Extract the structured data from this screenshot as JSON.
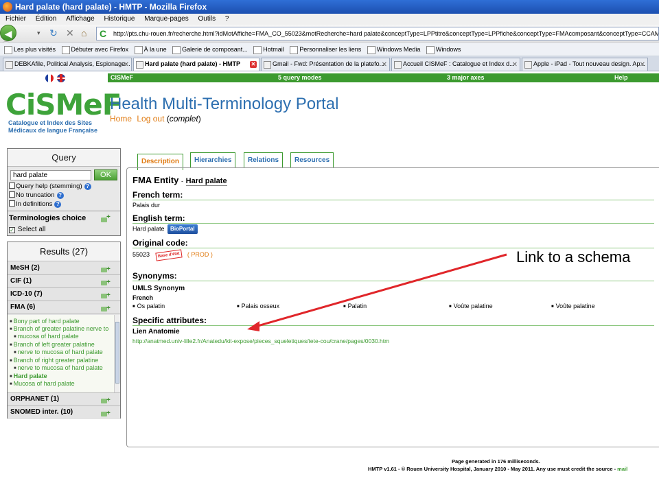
{
  "window": {
    "title": "Hard palate (hard palate) - HMTP - Mozilla Firefox"
  },
  "menu": [
    "Fichier",
    "Édition",
    "Affichage",
    "Historique",
    "Marque-pages",
    "Outils",
    "?"
  ],
  "url": "http://pts.chu-rouen.fr/recherche.html?idMotAffiche=FMA_CO_55023&motRecherche=hard palate&conceptType=LPPtitre&conceptType=LPPfiche&conceptType=FMAcomposant&conceptType=CCAMorgane&conceptTyp",
  "bookmarks": [
    "Les plus visités",
    "Débuter avec Firefox",
    "À la une",
    "Galerie de composant...",
    "Hotmail",
    "Personnaliser les liens",
    "Windows Media",
    "Windows"
  ],
  "tabs": [
    {
      "label": "DEBKAfile, Political Analysis, Espionage..."
    },
    {
      "label": "Hard palate (hard palate) - HMTP"
    },
    {
      "label": "Gmail - Fwd: Présentation de la platefo..."
    },
    {
      "label": "Accueil CISMeF : Catalogue et Index d..."
    },
    {
      "label": "Apple - iPad - Tout nouveau design. Ap..."
    }
  ],
  "topnav": {
    "brand": "CISMeF",
    "modes": "5 query modes",
    "axes": "3 major axes",
    "help": "Help"
  },
  "logo": {
    "word": "CiSMeF",
    "sub1": "Catalogue et Index des Sites",
    "sub2": "Médicaux de langue Française"
  },
  "portal": {
    "title": "Health Multi-Terminology Portal",
    "home": "Home",
    "logout": "Log out",
    "open": "(",
    "mode": "complet",
    "close": ")"
  },
  "query": {
    "title": "Query",
    "value": "hard palate",
    "ok": "OK",
    "opt1": "Query help (stemming)",
    "opt2": "No truncation",
    "opt3": "In definitions",
    "terminologies": "Terminologies choice",
    "select_all": "Select all"
  },
  "results": {
    "title": "Results (27)",
    "mesh": "MeSH (2)",
    "cif": "CIF (1)",
    "icd": "ICD-10 (7)",
    "fma": "FMA (6)",
    "fma_items": [
      "Bony part of hard palate",
      "Branch of greater palatine nerve to",
      "mucosa of hard palate",
      "Branch of left greater palatine",
      "nerve to mucosa of hard palate",
      "Branch of right greater palatine",
      "nerve to mucosa of hard palate",
      "Hard palate",
      "Mucosa of hard palate"
    ],
    "orphanet": "ORPHANET (1)",
    "snomed": "SNOMED inter. (10)"
  },
  "content_tabs": [
    "Description",
    "Hierarchies",
    "Relations",
    "Resources"
  ],
  "entity": {
    "label": "FMA Entity",
    "dash": "-",
    "name": "Hard palate"
  },
  "french_term": {
    "title": "French term:",
    "value": "Palais dur"
  },
  "english_term": {
    "title": "English term:",
    "value": "Hard palate",
    "bioportal": "BioPortal"
  },
  "original_code": {
    "title": "Original code:",
    "value": "55023",
    "stamp": "Base d'état",
    "status": "( PROD )"
  },
  "synonyms": {
    "title": "Synonyms:",
    "umls": "UMLS Synonym",
    "lang": "French",
    "items": [
      "Os palatin",
      "Palais osseux",
      "Palatin",
      "Voûte palatine",
      "Voûte palatine"
    ]
  },
  "specific": {
    "title": "Specific attributes:",
    "lien": "Lien Anatomie",
    "url": "http://anatmed.univ-lille2.fr/Anatedu/kit-expose/pieces_squeletiques/tete-cou/crane/pages/0030.htm"
  },
  "annotation": "Link to a schema",
  "footer": {
    "line1": "Page generated in 176 milliseconds.",
    "line2": "HMTP v1.61 - © Rouen University Hospital, January 2010 - May 2011. Any use must credit the source -",
    "mail": "mail"
  },
  "colors": {
    "green": "#3c9a2f",
    "blue": "#2d6fb0",
    "orange": "#e07a10",
    "arrow": "#e0262a"
  }
}
